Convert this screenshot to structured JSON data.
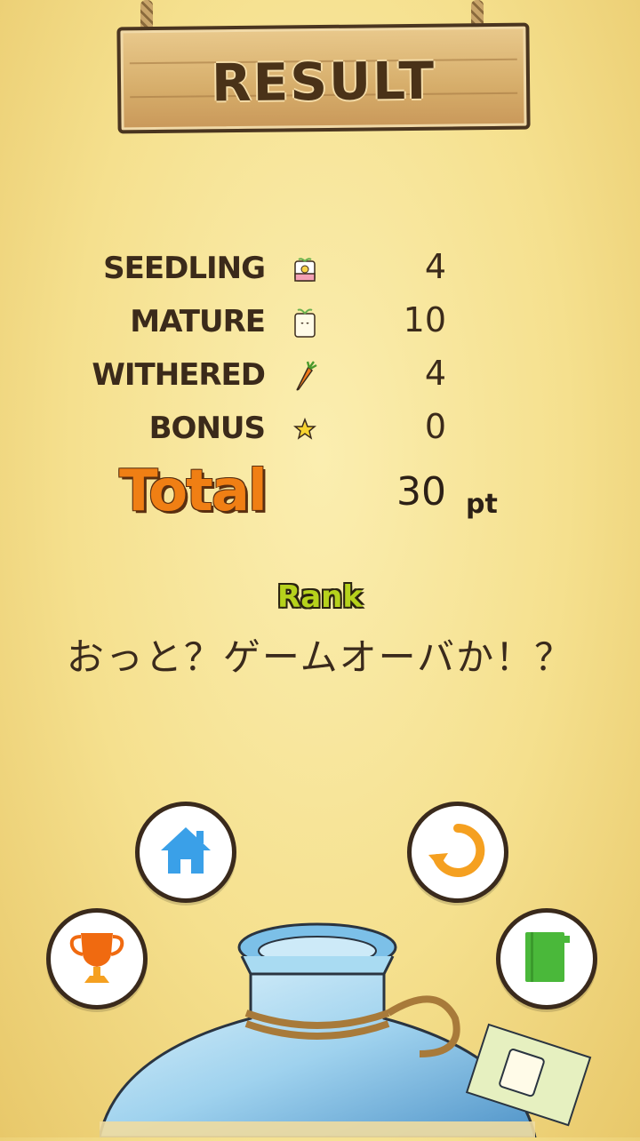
{
  "header": {
    "title": "RESULT"
  },
  "stats": [
    {
      "label": "SEEDLING",
      "icon": "seedling-icon",
      "value": "4"
    },
    {
      "label": "MATURE",
      "icon": "mature-plant-icon",
      "value": "10"
    },
    {
      "label": "WITHERED",
      "icon": "carrot-icon",
      "value": "4"
    },
    {
      "label": "BONUS",
      "icon": "star-icon",
      "value": "0"
    }
  ],
  "total": {
    "label": "Total",
    "value": "30",
    "unit": "pt"
  },
  "rank": {
    "label": "Rank",
    "text": "おっと？ゲームオーバか！？"
  },
  "buttons": {
    "home": "home-icon",
    "retry": "retry-icon",
    "trophy": "trophy-icon",
    "book": "book-icon"
  },
  "colors": {
    "background": "#f5e08e",
    "total_orange": "#f07f14",
    "rank_green": "#b6d21c",
    "home_blue": "#3aa0e8",
    "retry_orange": "#f5a020",
    "trophy_orange": "#f06a10",
    "book_green": "#4ab83a"
  }
}
